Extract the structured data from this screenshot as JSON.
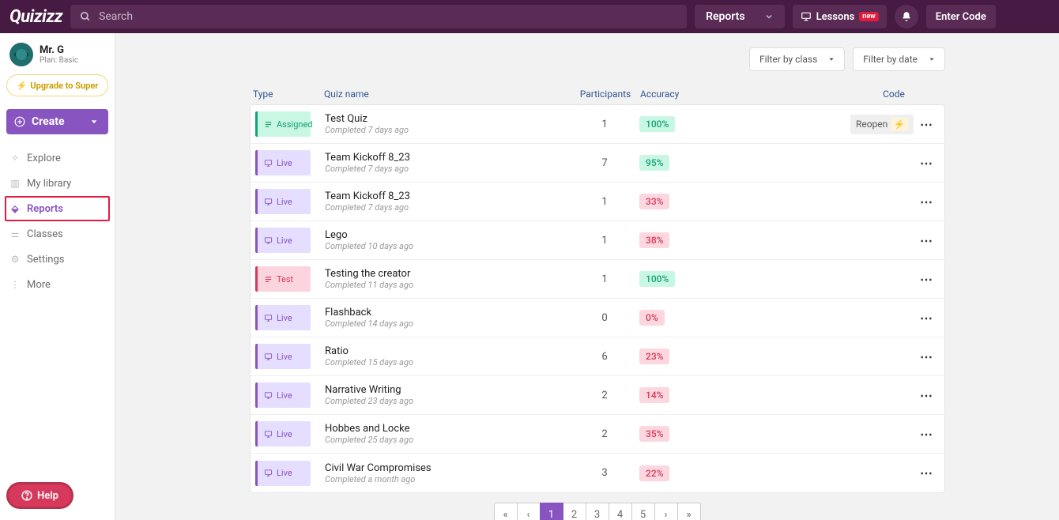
{
  "header": {
    "logo": "Quizizz",
    "search_placeholder": "Search",
    "reports_dropdown": "Reports",
    "lessons_label": "Lessons",
    "new_badge": "new",
    "enter_code": "Enter Code"
  },
  "sidebar": {
    "user_name": "Mr. G",
    "user_plan": "Plan: Basic",
    "upgrade_label": "Upgrade to Super",
    "create_label": "Create",
    "nav": {
      "explore": "Explore",
      "library": "My library",
      "reports": "Reports",
      "classes": "Classes",
      "settings": "Settings",
      "more": "More"
    },
    "help_label": "Help"
  },
  "filters": {
    "by_class": "Filter by class",
    "by_date": "Filter by date"
  },
  "columns": {
    "type": "Type",
    "name": "Quiz name",
    "participants": "Participants",
    "accuracy": "Accuracy",
    "code": "Code"
  },
  "types": {
    "assigned": "Assigned",
    "live": "Live",
    "test": "Test"
  },
  "code_reopen": "Reopen",
  "rows": [
    {
      "type": "assigned",
      "name": "Test Quiz",
      "sub": "Completed 7 days ago",
      "participants": "1",
      "accuracy": "100%",
      "acc_kind": "green",
      "reopen": true
    },
    {
      "type": "live",
      "name": "Team Kickoff 8_23",
      "sub": "Completed 7 days ago",
      "participants": "7",
      "accuracy": "95%",
      "acc_kind": "green",
      "reopen": false
    },
    {
      "type": "live",
      "name": "Team Kickoff 8_23",
      "sub": "Completed 7 days ago",
      "participants": "1",
      "accuracy": "33%",
      "acc_kind": "red",
      "reopen": false
    },
    {
      "type": "live",
      "name": "Lego",
      "sub": "Completed 10 days ago",
      "participants": "1",
      "accuracy": "38%",
      "acc_kind": "red",
      "reopen": false
    },
    {
      "type": "test",
      "name": "Testing the creator",
      "sub": "Completed 11 days ago",
      "participants": "1",
      "accuracy": "100%",
      "acc_kind": "green",
      "reopen": false
    },
    {
      "type": "live",
      "name": "Flashback",
      "sub": "Completed 14 days ago",
      "participants": "0",
      "accuracy": "0%",
      "acc_kind": "red",
      "reopen": false
    },
    {
      "type": "live",
      "name": "Ratio",
      "sub": "Completed 15 days ago",
      "participants": "6",
      "accuracy": "23%",
      "acc_kind": "red",
      "reopen": false
    },
    {
      "type": "live",
      "name": "Narrative Writing",
      "sub": "Completed 23 days ago",
      "participants": "2",
      "accuracy": "14%",
      "acc_kind": "red",
      "reopen": false
    },
    {
      "type": "live",
      "name": "Hobbes and Locke",
      "sub": "Completed 25 days ago",
      "participants": "2",
      "accuracy": "35%",
      "acc_kind": "red",
      "reopen": false
    },
    {
      "type": "live",
      "name": "Civil War Compromises",
      "sub": "Completed a month ago",
      "participants": "3",
      "accuracy": "22%",
      "acc_kind": "red",
      "reopen": false
    }
  ],
  "pagination": {
    "pages": [
      "1",
      "2",
      "3",
      "4",
      "5"
    ],
    "active": "1"
  }
}
